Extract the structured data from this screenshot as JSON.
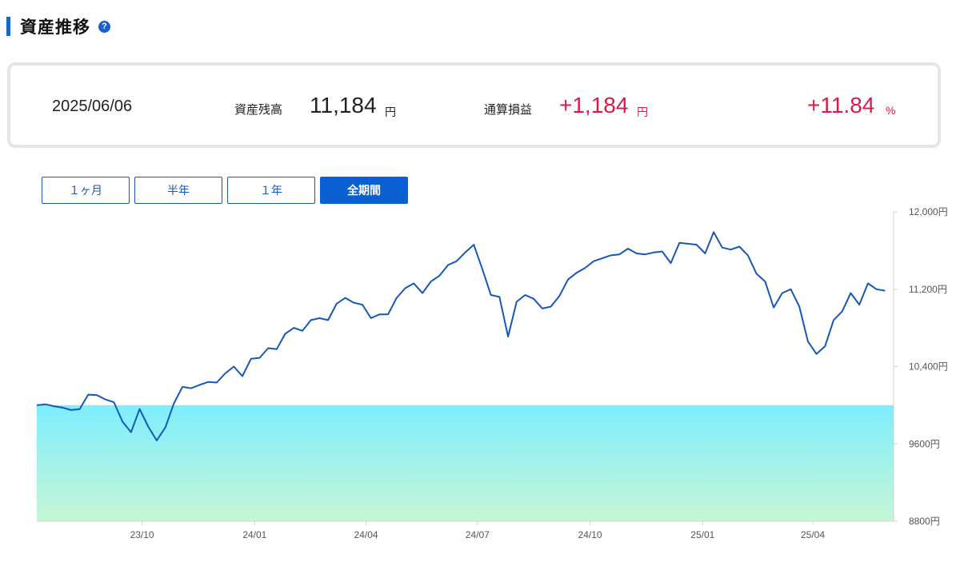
{
  "header": {
    "title": "資産推移",
    "help_icon": "question-circle-icon"
  },
  "summary": {
    "date": "2025/06/06",
    "balance_label": "資産残高",
    "balance_value": "11,184",
    "balance_unit": "円",
    "pnl_label": "通算損益",
    "pnl_value": "+1,184",
    "pnl_unit": "円",
    "pnl_pct": "+11.84",
    "pnl_pct_unit": "%"
  },
  "periods": [
    {
      "label": "１ヶ月",
      "active": false
    },
    {
      "label": "半年",
      "active": false
    },
    {
      "label": "１年",
      "active": false
    },
    {
      "label": "全期間",
      "active": true
    }
  ],
  "colors": {
    "line": "#1757b8",
    "fill_top": "#7eeefd",
    "fill_bottom": "#c6f6d5",
    "positive": "#d81b48",
    "accent": "#0a5fd3"
  },
  "chart_data": {
    "type": "area",
    "x_tick_labels": [
      "23/10",
      "24/01",
      "24/04",
      "24/07",
      "24/10",
      "25/01",
      "25/04"
    ],
    "y_tick_labels": [
      "12,000円",
      "11,200円",
      "10,400円",
      "9600円",
      "8800円"
    ],
    "ylim": [
      8800,
      12000
    ],
    "baseline": 10000,
    "x_start": "2023-07-07",
    "x_end": "2025-06-06",
    "series": [
      {
        "values": [
          [
            "2023-07-07",
            10000
          ],
          [
            "2023-07-14",
            10010
          ],
          [
            "2023-07-21",
            9990
          ],
          [
            "2023-07-28",
            9975
          ],
          [
            "2023-08-04",
            9950
          ],
          [
            "2023-08-11",
            9960
          ],
          [
            "2023-08-18",
            10110
          ],
          [
            "2023-08-25",
            10105
          ],
          [
            "2023-09-01",
            10060
          ],
          [
            "2023-09-08",
            10030
          ],
          [
            "2023-09-15",
            9830
          ],
          [
            "2023-09-22",
            9720
          ],
          [
            "2023-09-29",
            9960
          ],
          [
            "2023-10-06",
            9780
          ],
          [
            "2023-10-13",
            9635
          ],
          [
            "2023-10-20",
            9770
          ],
          [
            "2023-10-27",
            10020
          ],
          [
            "2023-11-03",
            10190
          ],
          [
            "2023-11-10",
            10175
          ],
          [
            "2023-11-17",
            10210
          ],
          [
            "2023-11-24",
            10240
          ],
          [
            "2023-12-01",
            10235
          ],
          [
            "2023-12-08",
            10330
          ],
          [
            "2023-12-15",
            10400
          ],
          [
            "2023-12-22",
            10300
          ],
          [
            "2023-12-29",
            10480
          ],
          [
            "2024-01-05",
            10490
          ],
          [
            "2024-01-12",
            10590
          ],
          [
            "2024-01-19",
            10580
          ],
          [
            "2024-01-26",
            10740
          ],
          [
            "2024-02-02",
            10800
          ],
          [
            "2024-02-09",
            10770
          ],
          [
            "2024-02-16",
            10880
          ],
          [
            "2024-02-23",
            10900
          ],
          [
            "2024-03-01",
            10880
          ],
          [
            "2024-03-08",
            11050
          ],
          [
            "2024-03-15",
            11110
          ],
          [
            "2024-03-22",
            11060
          ],
          [
            "2024-03-29",
            11040
          ],
          [
            "2024-04-05",
            10900
          ],
          [
            "2024-04-12",
            10940
          ],
          [
            "2024-04-19",
            10940
          ],
          [
            "2024-04-26",
            11110
          ],
          [
            "2024-05-03",
            11210
          ],
          [
            "2024-05-10",
            11260
          ],
          [
            "2024-05-17",
            11160
          ],
          [
            "2024-05-24",
            11280
          ],
          [
            "2024-05-31",
            11340
          ],
          [
            "2024-06-07",
            11450
          ],
          [
            "2024-06-14",
            11490
          ],
          [
            "2024-06-21",
            11580
          ],
          [
            "2024-06-28",
            11660
          ],
          [
            "2024-07-05",
            11410
          ],
          [
            "2024-07-12",
            11140
          ],
          [
            "2024-07-19",
            11120
          ],
          [
            "2024-07-26",
            10710
          ],
          [
            "2024-08-02",
            11070
          ],
          [
            "2024-08-09",
            11140
          ],
          [
            "2024-08-16",
            11100
          ],
          [
            "2024-08-23",
            11000
          ],
          [
            "2024-08-30",
            11020
          ],
          [
            "2024-09-06",
            11130
          ],
          [
            "2024-09-13",
            11300
          ],
          [
            "2024-09-20",
            11370
          ],
          [
            "2024-09-27",
            11420
          ],
          [
            "2024-10-04",
            11490
          ],
          [
            "2024-10-11",
            11520
          ],
          [
            "2024-10-18",
            11550
          ],
          [
            "2024-10-25",
            11560
          ],
          [
            "2024-11-01",
            11620
          ],
          [
            "2024-11-08",
            11570
          ],
          [
            "2024-11-15",
            11560
          ],
          [
            "2024-11-22",
            11580
          ],
          [
            "2024-11-29",
            11590
          ],
          [
            "2024-12-06",
            11470
          ],
          [
            "2024-12-13",
            11680
          ],
          [
            "2024-12-20",
            11670
          ],
          [
            "2024-12-27",
            11660
          ],
          [
            "2025-01-03",
            11570
          ],
          [
            "2025-01-10",
            11790
          ],
          [
            "2025-01-17",
            11630
          ],
          [
            "2025-01-24",
            11610
          ],
          [
            "2025-01-31",
            11640
          ],
          [
            "2025-02-07",
            11550
          ],
          [
            "2025-02-14",
            11360
          ],
          [
            "2025-02-21",
            11280
          ],
          [
            "2025-02-28",
            11010
          ],
          [
            "2025-03-07",
            11160
          ],
          [
            "2025-03-14",
            11200
          ],
          [
            "2025-03-21",
            11020
          ],
          [
            "2025-03-28",
            10660
          ],
          [
            "2025-04-04",
            10530
          ],
          [
            "2025-04-11",
            10610
          ],
          [
            "2025-04-18",
            10880
          ],
          [
            "2025-04-25",
            10970
          ],
          [
            "2025-05-02",
            11160
          ],
          [
            "2025-05-09",
            11040
          ],
          [
            "2025-05-16",
            11260
          ],
          [
            "2025-05-23",
            11200
          ],
          [
            "2025-05-30",
            11184
          ]
        ]
      }
    ]
  }
}
